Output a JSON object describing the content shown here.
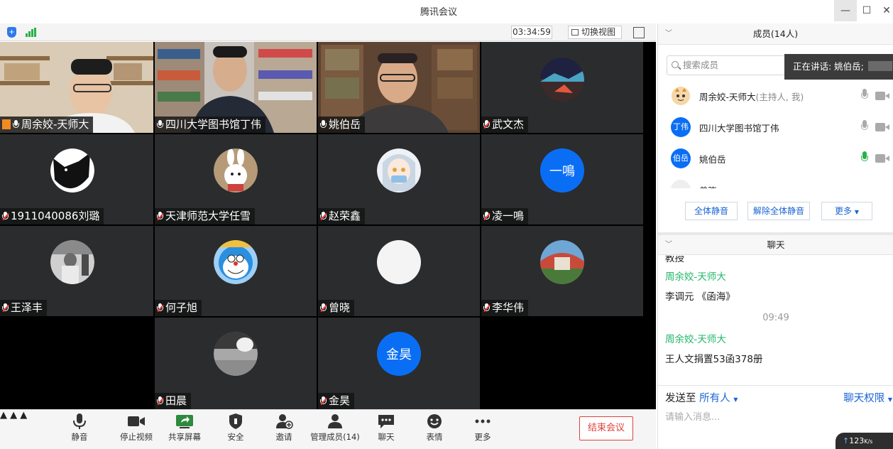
{
  "window": {
    "title": "腾讯会议"
  },
  "topbar": {
    "timer": "03:34:59",
    "switch_view": "切换视图"
  },
  "tiles": [
    {
      "name": "周余姣-天师大",
      "muted": false,
      "video": true,
      "host": true
    },
    {
      "name": "四川大学图书馆丁伟",
      "muted": false,
      "video": true
    },
    {
      "name": "姚伯岳",
      "muted": false,
      "video": true,
      "active": true
    },
    {
      "name": "武文杰",
      "muted": true
    },
    {
      "name": "1911040086刘璐",
      "muted": true
    },
    {
      "name": "天津师范大学任雪",
      "muted": true
    },
    {
      "name": "赵荣鑫",
      "muted": true
    },
    {
      "name": "凌一鳴",
      "muted": true,
      "avatar_text": "一鳴"
    },
    {
      "name": "王泽丰",
      "muted": true
    },
    {
      "name": "何子旭",
      "muted": true
    },
    {
      "name": "曾晓",
      "muted": true
    },
    {
      "name": "李华伟",
      "muted": true
    },
    {
      "name": "田晨",
      "muted": true
    },
    {
      "name": "金昊",
      "muted": true,
      "avatar_text": "金昊"
    }
  ],
  "toolbar": {
    "mute": "静音",
    "stop_video": "停止视频",
    "share_screen": "共享屏幕",
    "security": "安全",
    "invite": "邀请",
    "manage_members": "管理成员(14)",
    "chat": "聊天",
    "emoji": "表情",
    "more": "更多",
    "end_meeting": "结束会议"
  },
  "members_panel": {
    "title": "成员(14人)",
    "search_placeholder": "搜索成员",
    "speaking": "正在讲话: 姚伯岳;",
    "members": [
      {
        "name": "周余姣-天师大",
        "role": "(主持人, 我)",
        "avatar": ""
      },
      {
        "name": "四川大学图书馆丁伟",
        "avatar": "丁伟"
      },
      {
        "name": "姚伯岳",
        "avatar": "伯岳"
      },
      {
        "name": "曾晓",
        "avatar": ""
      }
    ],
    "mute_all": "全体静音",
    "unmute_all": "解除全体静音",
    "more": "更多"
  },
  "chat_panel": {
    "title": "聊天",
    "partial_line": "教授",
    "messages": [
      {
        "sender": "周余姣-天师大",
        "text": "李调元 《函海》"
      },
      {
        "time": "09:49"
      },
      {
        "sender": "周余姣-天师大",
        "text": "王人文捐置53函378册"
      }
    ],
    "send_to_label": "发送至",
    "send_to_target": "所有人",
    "chat_permission": "聊天权限",
    "input_placeholder": "请输入消息...",
    "net_speed": "123",
    "net_unit": "K/s"
  },
  "colors": {
    "accent": "#0a6ef5",
    "speaking_green": "#23c063",
    "end_red": "#e0403a",
    "link_blue": "#1a64d6"
  }
}
